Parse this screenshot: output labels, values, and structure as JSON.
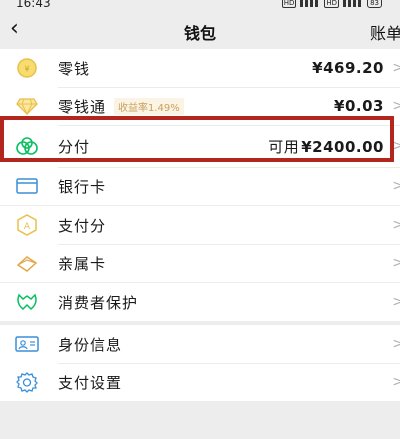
{
  "status": {
    "time": "16:43",
    "network1": "HD",
    "network2": "HD",
    "battery": "83"
  },
  "nav": {
    "back_icon": "chevron-left-icon",
    "title": "钱包",
    "right_label": "账单"
  },
  "groups": [
    {
      "rows": [
        {
          "icon": "coin-icon",
          "label": "零钱",
          "value": "¥469.20"
        },
        {
          "icon": "diamond-icon",
          "label": "零钱通",
          "tag": "收益率1.49%",
          "value": "¥0.03"
        },
        {
          "icon": "fenfu-icon",
          "label": "分付",
          "value_prefix": "可用",
          "value": "¥2400.00"
        },
        {
          "icon": "bank-card-icon",
          "label": "银行卡"
        }
      ]
    },
    {
      "rows": [
        {
          "icon": "pay-score-icon",
          "label": "支付分"
        },
        {
          "icon": "family-card-icon",
          "label": "亲属卡"
        }
      ]
    },
    {
      "rows": [
        {
          "icon": "consumer-protection-icon",
          "label": "消费者保护"
        }
      ]
    },
    {
      "rows": [
        {
          "icon": "id-info-icon",
          "label": "身份信息"
        },
        {
          "icon": "settings-gear-icon",
          "label": "支付设置"
        }
      ]
    }
  ],
  "colors": {
    "accent_green": "#07c160",
    "gold": "#e8c04a",
    "highlight_red": "#b3261e"
  }
}
